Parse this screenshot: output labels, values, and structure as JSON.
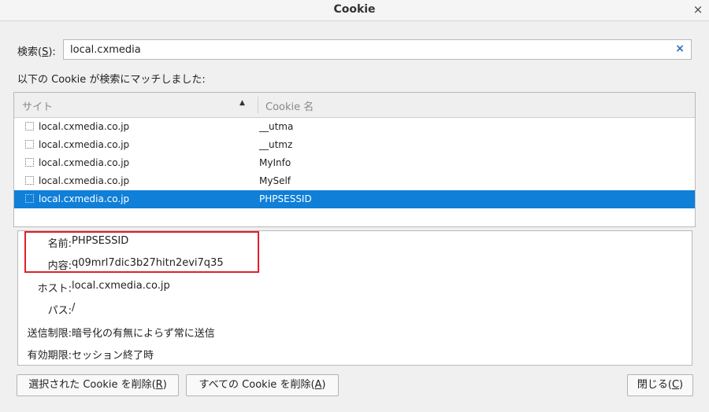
{
  "window": {
    "title": "Cookie",
    "close_glyph": "×"
  },
  "search": {
    "label_prefix": "検索(",
    "label_accel": "S",
    "label_suffix": "):",
    "value": "local.cxmedia",
    "clear_glyph": "×"
  },
  "match_label": "以下の Cookie が検索にマッチしました:",
  "table": {
    "columns": {
      "site": "サイト",
      "name": "Cookie 名"
    },
    "sort_glyph": "▲",
    "rows": [
      {
        "site": "local.cxmedia.co.jp",
        "name": "__utma",
        "selected": false
      },
      {
        "site": "local.cxmedia.co.jp",
        "name": "__utmz",
        "selected": false
      },
      {
        "site": "local.cxmedia.co.jp",
        "name": "MyInfo",
        "selected": false
      },
      {
        "site": "local.cxmedia.co.jp",
        "name": "MySelf",
        "selected": false
      },
      {
        "site": "local.cxmedia.co.jp",
        "name": "PHPSESSID",
        "selected": true
      }
    ]
  },
  "details": {
    "name_label": "名前:",
    "name_value": "PHPSESSID",
    "content_label": "内容:",
    "content_value": "q09mrl7dic3b27hitn2evi7q35",
    "host_label": "ホスト:",
    "host_value": "local.cxmedia.co.jp",
    "path_label": "パス:",
    "path_value": "/",
    "send_label": "送信制限:",
    "send_value": "暗号化の有無によらず常に送信",
    "expires_label": "有効期限:",
    "expires_value": "セッション終了時"
  },
  "buttons": {
    "delete_selected": {
      "prefix": "選択された Cookie を削除(",
      "accel": "R",
      "suffix": ")"
    },
    "delete_all": {
      "prefix": "すべての Cookie を削除(",
      "accel": "A",
      "suffix": ")"
    },
    "close": {
      "prefix": "閉じる(",
      "accel": "C",
      "suffix": ")"
    }
  },
  "colors": {
    "selection": "#0f7fd8",
    "highlight_box": "#e0202a",
    "clear_icon": "#2a6fb6"
  }
}
